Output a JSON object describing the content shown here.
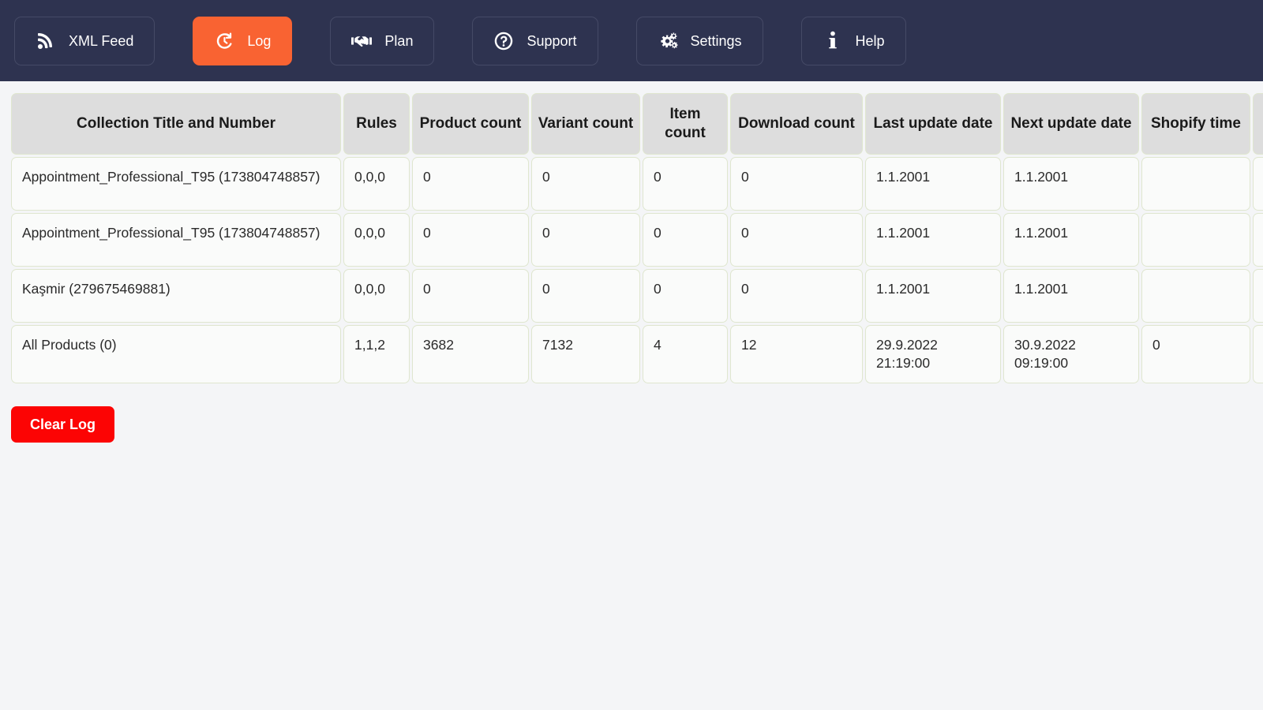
{
  "nav": {
    "items": [
      {
        "label": "XML Feed",
        "icon": "rss-icon",
        "active": false
      },
      {
        "label": "Log",
        "icon": "history-icon",
        "active": true
      },
      {
        "label": "Plan",
        "icon": "handshake-icon",
        "active": false
      },
      {
        "label": "Support",
        "icon": "question-circle-icon",
        "active": false
      },
      {
        "label": "Settings",
        "icon": "cogs-icon",
        "active": false
      },
      {
        "label": "Help",
        "icon": "info-icon",
        "active": false
      }
    ],
    "background_color": "#2e3350",
    "active_color": "#f96332"
  },
  "table": {
    "headers": [
      "Collection Title and Number",
      "Rules",
      "Product count",
      "Variant count",
      "Item count",
      "Download count",
      "Last update date",
      "Next update date",
      "Shopify time",
      ""
    ],
    "rows": [
      {
        "title": "Appointment_Professional_T95 (173804748857)",
        "rules": "0,0,0",
        "product_count": "0",
        "variant_count": "0",
        "item_count": "0",
        "download_count": "0",
        "last_update_date": "1.1.2001",
        "last_update_time": "",
        "next_update_date": "1.1.2001",
        "next_update_time": "",
        "shopify_time": "",
        "extra": ""
      },
      {
        "title": "Appointment_Professional_T95 (173804748857)",
        "rules": "0,0,0",
        "product_count": "0",
        "variant_count": "0",
        "item_count": "0",
        "download_count": "0",
        "last_update_date": "1.1.2001",
        "last_update_time": "",
        "next_update_date": "1.1.2001",
        "next_update_time": "",
        "shopify_time": "",
        "extra": ""
      },
      {
        "title": "Kaşmir (279675469881)",
        "rules": "0,0,0",
        "product_count": "0",
        "variant_count": "0",
        "item_count": "0",
        "download_count": "0",
        "last_update_date": "1.1.2001",
        "last_update_time": "",
        "next_update_date": "1.1.2001",
        "next_update_time": "",
        "shopify_time": "",
        "extra": ""
      },
      {
        "title": "All Products (0)",
        "rules": "1,1,2",
        "product_count": "3682",
        "variant_count": "7132",
        "item_count": "4",
        "download_count": "12",
        "last_update_date": "29.9.2022",
        "last_update_time": "21:19:00",
        "next_update_date": "30.9.2022",
        "next_update_time": "09:19:00",
        "shopify_time": "0",
        "extra": ""
      }
    ],
    "header_bg": "#dddddd",
    "cell_border": "#dfe6cf"
  },
  "actions": {
    "clear_log_label": "Clear Log",
    "clear_log_color": "#fc0404"
  }
}
